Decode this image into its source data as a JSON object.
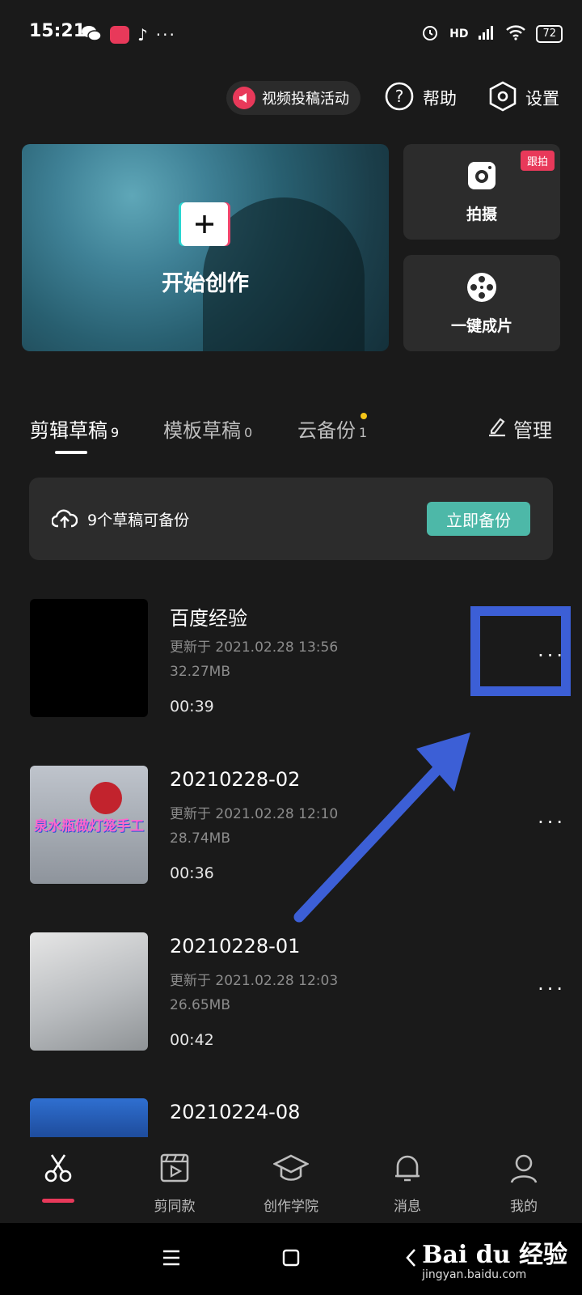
{
  "status_bar": {
    "time": "15:21",
    "network": "HD",
    "battery": "72"
  },
  "header": {
    "promo_label": "视频投稿活动",
    "help_label": "帮助",
    "settings_label": "设置"
  },
  "create": {
    "label": "开始创作"
  },
  "shortcuts": {
    "shoot_label": "拍摄",
    "follow_badge": "跟拍",
    "oneclick_label": "一键成片"
  },
  "tabs": [
    {
      "label": "剪辑草稿",
      "count": "9"
    },
    {
      "label": "模板草稿",
      "count": "0"
    },
    {
      "label": "云备份",
      "count": "1"
    }
  ],
  "manage_label": "管理",
  "backup": {
    "text": "9个草稿可备份",
    "button": "立即备份"
  },
  "drafts": [
    {
      "title": "百度经验",
      "updated": "更新于 2021.02.28 13:56",
      "size": "32.27MB",
      "duration": "00:39"
    },
    {
      "title": "20210228-02",
      "updated": "更新于 2021.02.28 12:10",
      "size": "28.74MB",
      "duration": "00:36",
      "thumb_caption": "泉水瓶做灯笼手工"
    },
    {
      "title": "20210228-01",
      "updated": "更新于 2021.02.28 12:03",
      "size": "26.65MB",
      "duration": "00:42"
    },
    {
      "title": "20210224-08"
    }
  ],
  "more_glyph": "···",
  "bottom_nav": [
    {
      "label": "",
      "icon": "scissors-icon"
    },
    {
      "label": "剪同款",
      "icon": "film-play-icon"
    },
    {
      "label": "创作学院",
      "icon": "graduation-cap-icon"
    },
    {
      "label": "消息",
      "icon": "bell-icon"
    },
    {
      "label": "我的",
      "icon": "person-icon"
    }
  ],
  "watermark": {
    "logo": "Bai du 经验",
    "url": "jingyan.baidu.com"
  },
  "colors": {
    "background": "#1a1a1a",
    "card": "#2c2c2c",
    "accent_pink": "#e8395a",
    "teal_button": "#4db8a8",
    "annotation_blue": "#3c5fd6"
  }
}
